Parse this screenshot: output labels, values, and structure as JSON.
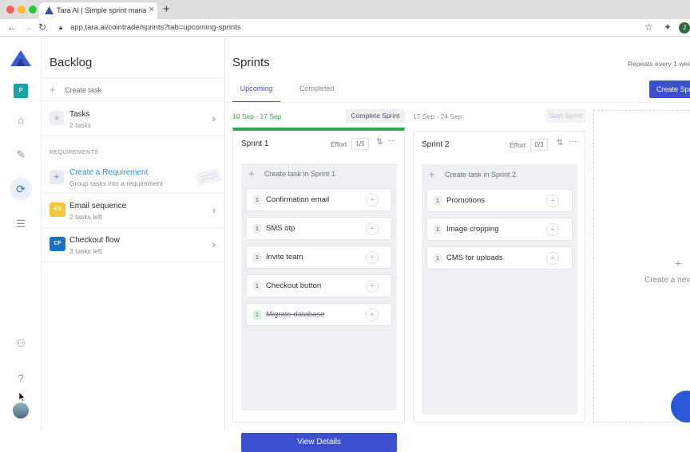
{
  "browser": {
    "tab_title": "Tara AI | Simple sprint manage",
    "url": "app.tara.ai/cointrade/sprints?tab=upcoming-sprints",
    "profile_initial": "J"
  },
  "rail": {
    "workspace_initial": "P"
  },
  "backlog": {
    "title": "Backlog",
    "create_task": "Create task",
    "tasks": {
      "title": "Tasks",
      "sub": "2 tasks"
    },
    "requirements_header": "REQUIREMENTS",
    "create_req": {
      "title": "Create a Requirement",
      "sub": "Group tasks into a requirement"
    },
    "requirements": [
      {
        "badge": "ES",
        "title": "Email sequence",
        "sub": "2 tasks left",
        "color": "#f5c544"
      },
      {
        "badge": "CF",
        "title": "Checkout flow",
        "sub": "3 tasks left",
        "color": "#1971c2"
      }
    ]
  },
  "sprints": {
    "title": "Sprints",
    "repeats": "Repeats every 1 wee",
    "tabs": {
      "upcoming": "Upcoming",
      "completed": "Completed"
    },
    "create_button": "Create Spr",
    "sprint1": {
      "dates": "10 Sep - 17 Sep",
      "action": "Complete Sprint",
      "name": "Sprint 1",
      "effort_label": "Effort",
      "effort": "1/5",
      "create_task": "Create task in Sprint 1",
      "tasks": [
        {
          "n": "1",
          "label": "Confirmation email"
        },
        {
          "n": "1",
          "label": "SMS otp"
        },
        {
          "n": "1",
          "label": "Invite team"
        },
        {
          "n": "1",
          "label": "Checkout button"
        },
        {
          "n": "1",
          "label": "Migrate database"
        }
      ],
      "details": "View Details"
    },
    "sprint2": {
      "dates": "17 Sep - 24 Sep",
      "action": "Start Sprint",
      "name": "Sprint 2",
      "effort_label": "Effort",
      "effort": "0/3",
      "create_task": "Create task in Sprint 2",
      "tasks": [
        {
          "n": "1",
          "label": "Promotions"
        },
        {
          "n": "1",
          "label": "Image cropping"
        },
        {
          "n": "1",
          "label": "CMS for uploads"
        }
      ]
    },
    "new_sprint": "Create a nev"
  },
  "colors": {
    "accent": "#3d4fd1",
    "green": "#2fa84f",
    "link": "#2f8fcf"
  }
}
